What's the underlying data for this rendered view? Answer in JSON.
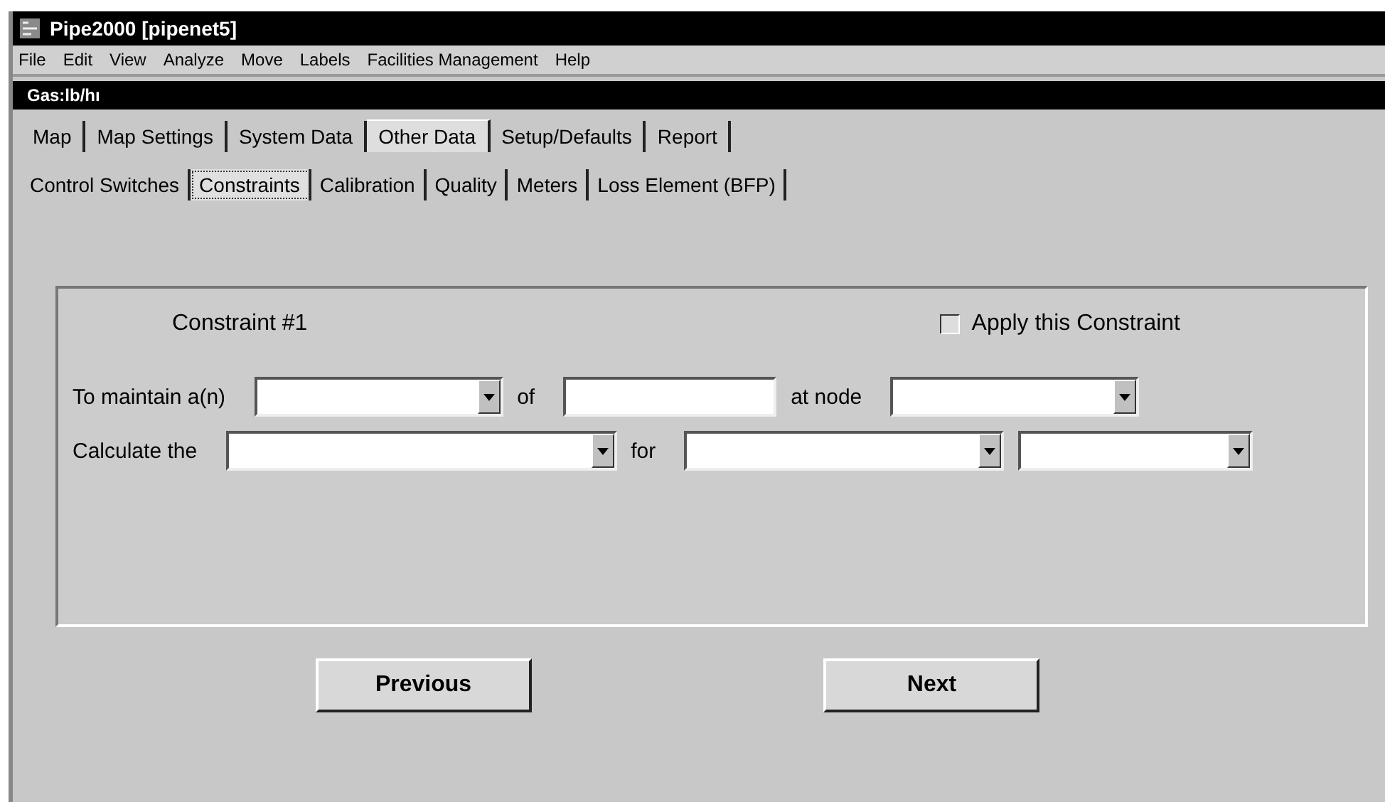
{
  "window": {
    "title": "Pipe2000  [pipenet5]"
  },
  "menu": [
    "File",
    "Edit",
    "View",
    "Analyze",
    "Move",
    "Labels",
    "Facilities Management",
    "Help"
  ],
  "sub_window": {
    "title": "Gas:lb/hı"
  },
  "tabs": [
    {
      "label": "Map",
      "selected": false
    },
    {
      "label": "Map Settings",
      "selected": false
    },
    {
      "label": "System Data",
      "selected": false
    },
    {
      "label": "Other Data",
      "selected": true
    },
    {
      "label": "Setup/Defaults",
      "selected": false
    },
    {
      "label": "Report",
      "selected": false
    }
  ],
  "sub_tabs": [
    {
      "label": "Control Switches",
      "selected": false
    },
    {
      "label": "Constraints",
      "selected": true
    },
    {
      "label": "Calibration",
      "selected": false
    },
    {
      "label": "Quality",
      "selected": false
    },
    {
      "label": "Meters",
      "selected": false
    },
    {
      "label": "Loss Element (BFP)",
      "selected": false
    }
  ],
  "panel": {
    "heading": "Constraint #1",
    "apply_checkbox": {
      "label": "Apply this Constraint",
      "checked": false
    },
    "rows": [
      {
        "fields": [
          {
            "kind": "label",
            "text": "To maintain a(n)"
          },
          {
            "kind": "combo"
          },
          {
            "kind": "label",
            "text": "of"
          },
          {
            "kind": "text"
          },
          {
            "kind": "label",
            "text": "at node"
          },
          {
            "kind": "combo"
          }
        ]
      },
      {
        "fields": [
          {
            "kind": "label",
            "text": "Calculate the"
          },
          {
            "kind": "combo"
          },
          {
            "kind": "label",
            "text": "for"
          },
          {
            "kind": "combo"
          },
          {
            "kind": "combo"
          }
        ]
      }
    ]
  },
  "buttons": [
    "Previous",
    "Next"
  ]
}
